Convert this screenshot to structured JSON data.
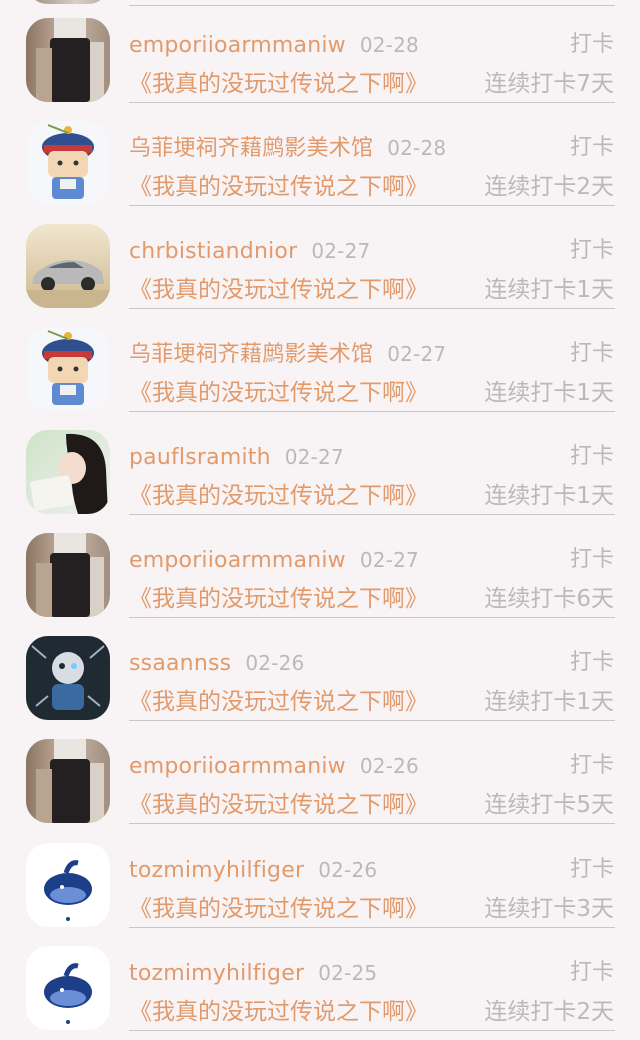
{
  "feed": {
    "items": [
      {
        "avatar": "avatar-photo-person-dark-pants",
        "name": "emporiioarmmaniw",
        "date": "02-28",
        "action": "打卡",
        "title": "《我真的没玩过传说之下啊》",
        "streak": "连续打卡7天"
      },
      {
        "avatar": "avatar-cartoon-qing-official",
        "name": "乌菲埂祠齐藉鹧影美术馆",
        "date": "02-28",
        "action": "打卡",
        "title": "《我真的没玩过传说之下啊》",
        "streak": "连续打卡2天"
      },
      {
        "avatar": "avatar-photo-silver-car",
        "name": "chrbistiandnior",
        "date": "02-27",
        "action": "打卡",
        "title": "《我真的没玩过传说之下啊》",
        "streak": "连续打卡1天"
      },
      {
        "avatar": "avatar-cartoon-qing-official",
        "name": "乌菲埂祠齐藉鹧影美术馆",
        "date": "02-27",
        "action": "打卡",
        "title": "《我真的没玩过传说之下啊》",
        "streak": "连续打卡1天"
      },
      {
        "avatar": "avatar-photo-girl-book",
        "name": "pauflsramith",
        "date": "02-27",
        "action": "打卡",
        "title": "《我真的没玩过传说之下啊》",
        "streak": "连续打卡1天"
      },
      {
        "avatar": "avatar-photo-person-dark-pants",
        "name": "emporiioarmmaniw",
        "date": "02-27",
        "action": "打卡",
        "title": "《我真的没玩过传说之下啊》",
        "streak": "连续打卡6天"
      },
      {
        "avatar": "avatar-dark-sans-art",
        "name": "ssaannss",
        "date": "02-26",
        "action": "打卡",
        "title": "《我真的没玩过传说之下啊》",
        "streak": "连续打卡1天"
      },
      {
        "avatar": "avatar-photo-person-dark-pants",
        "name": "emporiioarmmaniw",
        "date": "02-26",
        "action": "打卡",
        "title": "《我真的没玩过传说之下啊》",
        "streak": "连续打卡5天"
      },
      {
        "avatar": "avatar-blue-whale",
        "name": "tozmimyhilfiger",
        "date": "02-26",
        "action": "打卡",
        "title": "《我真的没玩过传说之下啊》",
        "streak": "连续打卡3天"
      },
      {
        "avatar": "avatar-blue-whale",
        "name": "tozmimyhilfiger",
        "date": "02-25",
        "action": "打卡",
        "title": "《我真的没玩过传说之下啊》",
        "streak": "连续打卡2天"
      }
    ]
  },
  "colors": {
    "background": "#f8f4f6",
    "accent": "#e39a6b",
    "muted": "#bdb7ba",
    "divider": "#c9c5c7"
  }
}
